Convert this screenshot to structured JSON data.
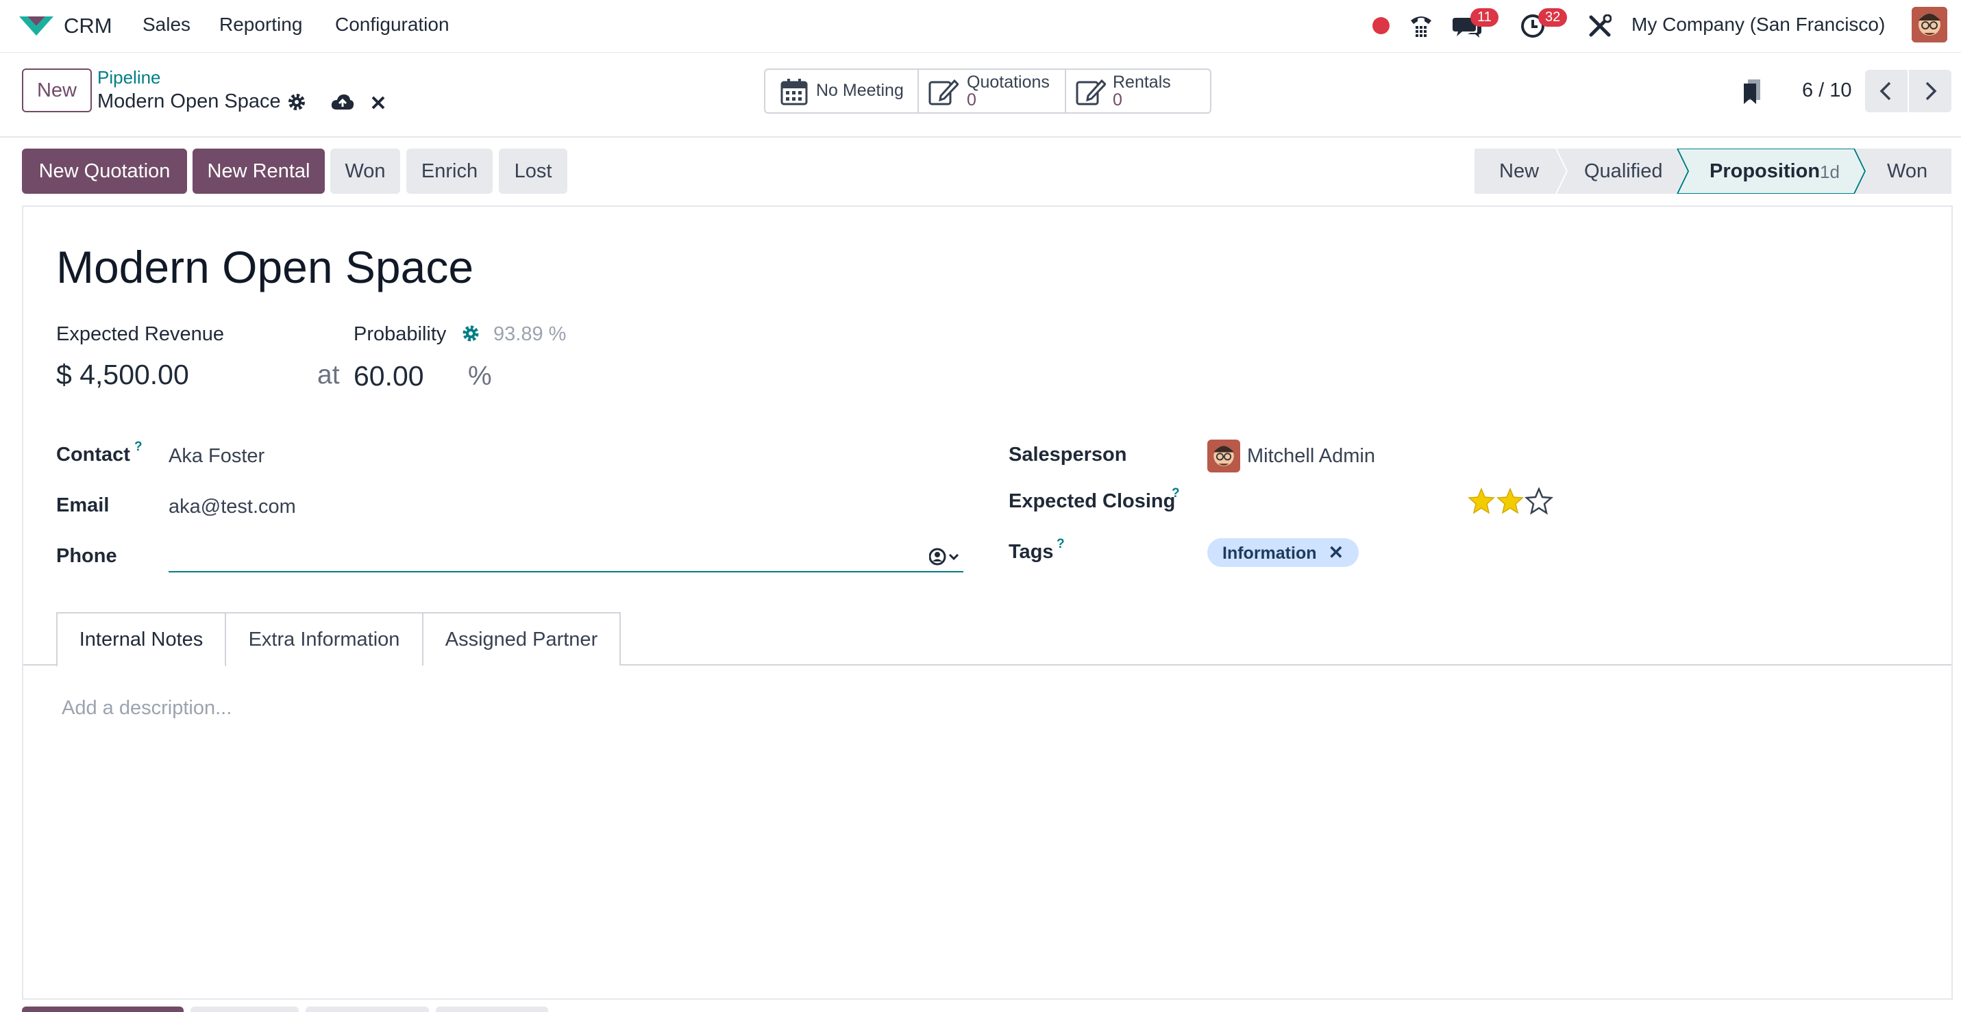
{
  "navbar": {
    "app_name": "CRM",
    "menu": [
      "Sales",
      "Reporting",
      "Configuration"
    ],
    "messages_count": "11",
    "activities_count": "32",
    "company": "My Company (San Francisco)"
  },
  "control_panel": {
    "new_label": "New",
    "breadcrumb_parent": "Pipeline",
    "record_name": "Modern Open Space",
    "smart_buttons": {
      "meeting": "No Meeting",
      "quotations_label": "Quotations",
      "quotations_count": "0",
      "rentals_label": "Rentals",
      "rentals_count": "0"
    },
    "pager": "6 / 10"
  },
  "actions": {
    "new_quotation": "New Quotation",
    "new_rental": "New Rental",
    "won": "Won",
    "enrich": "Enrich",
    "lost": "Lost"
  },
  "stages": {
    "items": [
      "New",
      "Qualified",
      "Proposition",
      "Won"
    ],
    "active": "Proposition",
    "active_duration": "1d"
  },
  "form": {
    "title": "Modern Open Space",
    "expected_revenue_label": "Expected Revenue",
    "expected_revenue": "$ 4,500.00",
    "at": "at",
    "probability_label": "Probability",
    "auto_probability": "93.89 %",
    "probability": "60.00",
    "percent": "%",
    "contact_label": "Contact",
    "contact": "Aka Foster",
    "email_label": "Email",
    "email": "aka@test.com",
    "phone_label": "Phone",
    "phone": "",
    "salesperson_label": "Salesperson",
    "salesperson": "Mitchell Admin",
    "expected_closing_label": "Expected Closing",
    "priority_stars": 2,
    "priority_max": 3,
    "tags_label": "Tags",
    "tags": [
      "Information"
    ],
    "help_mark": "?"
  },
  "tabs": {
    "items": [
      "Internal Notes",
      "Extra Information",
      "Assigned Partner"
    ],
    "active": "Internal Notes"
  },
  "notes": {
    "placeholder": "Add a description..."
  },
  "colors": {
    "brand": "#714B67",
    "accent": "#017e84",
    "badge": "#dc3545",
    "star": "#f3cc00",
    "tag_bg": "#cfe2ff"
  }
}
